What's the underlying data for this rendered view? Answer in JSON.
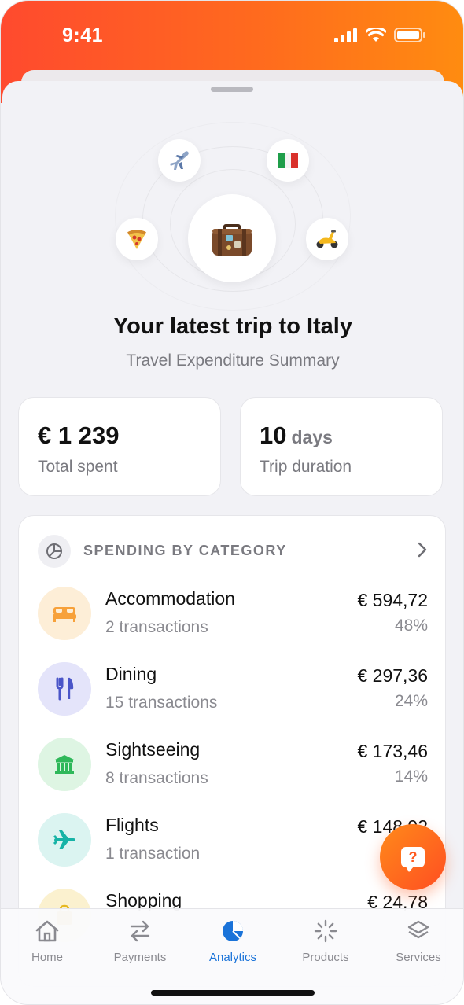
{
  "status_bar": {
    "time": "9:41"
  },
  "hero": {
    "center_emoji": "suitcase",
    "orbit_emojis": [
      "airplane",
      "italian-flag",
      "pizza",
      "scooter"
    ],
    "title": "Your latest trip to Italy",
    "subtitle": "Travel Expenditure Summary"
  },
  "stats": [
    {
      "value": "€ 1 239",
      "unit": "",
      "label": "Total spent"
    },
    {
      "value": "10",
      "unit": "days",
      "label": "Trip duration"
    }
  ],
  "categories": {
    "title": "SPENDING BY CATEGORY",
    "items": [
      {
        "name": "Accommodation",
        "count": "2 transactions",
        "amount": "€ 594,72",
        "pct": "48%",
        "icon": "bed-icon",
        "color": "#f7a13a",
        "bg": "#fdeed7"
      },
      {
        "name": "Dining",
        "count": "15 transactions",
        "amount": "€ 297,36",
        "pct": "24%",
        "icon": "fork-knife-icon",
        "color": "#4a55c8",
        "bg": "#e4e4fa"
      },
      {
        "name": "Sightseeing",
        "count": "8 transactions",
        "amount": "€ 173,46",
        "pct": "14%",
        "icon": "museum-icon",
        "color": "#2fb85a",
        "bg": "#def5e3"
      },
      {
        "name": "Flights",
        "count": "1 transaction",
        "amount": "€ 148,92",
        "pct": "",
        "icon": "airplane-icon",
        "color": "#16b3a6",
        "bg": "#dbf4f1"
      },
      {
        "name": "Shopping",
        "count": "",
        "amount": "€ 24,78",
        "pct": "",
        "icon": "shopping-icon",
        "color": "#e6b820",
        "bg": "#fbf1cf"
      }
    ]
  },
  "fab": {
    "label": "?"
  },
  "tabs": [
    {
      "label": "Home",
      "icon": "house-icon",
      "active": false
    },
    {
      "label": "Payments",
      "icon": "transfer-arrows-icon",
      "active": false
    },
    {
      "label": "Analytics",
      "icon": "pie-chart-icon",
      "active": true
    },
    {
      "label": "Products",
      "icon": "loader-icon",
      "active": false
    },
    {
      "label": "Services",
      "icon": "layers-icon",
      "active": false
    }
  ],
  "colors": {
    "accent": "#1a73d9",
    "brand_start": "#ff4a2e",
    "brand_end": "#ff8c10"
  }
}
